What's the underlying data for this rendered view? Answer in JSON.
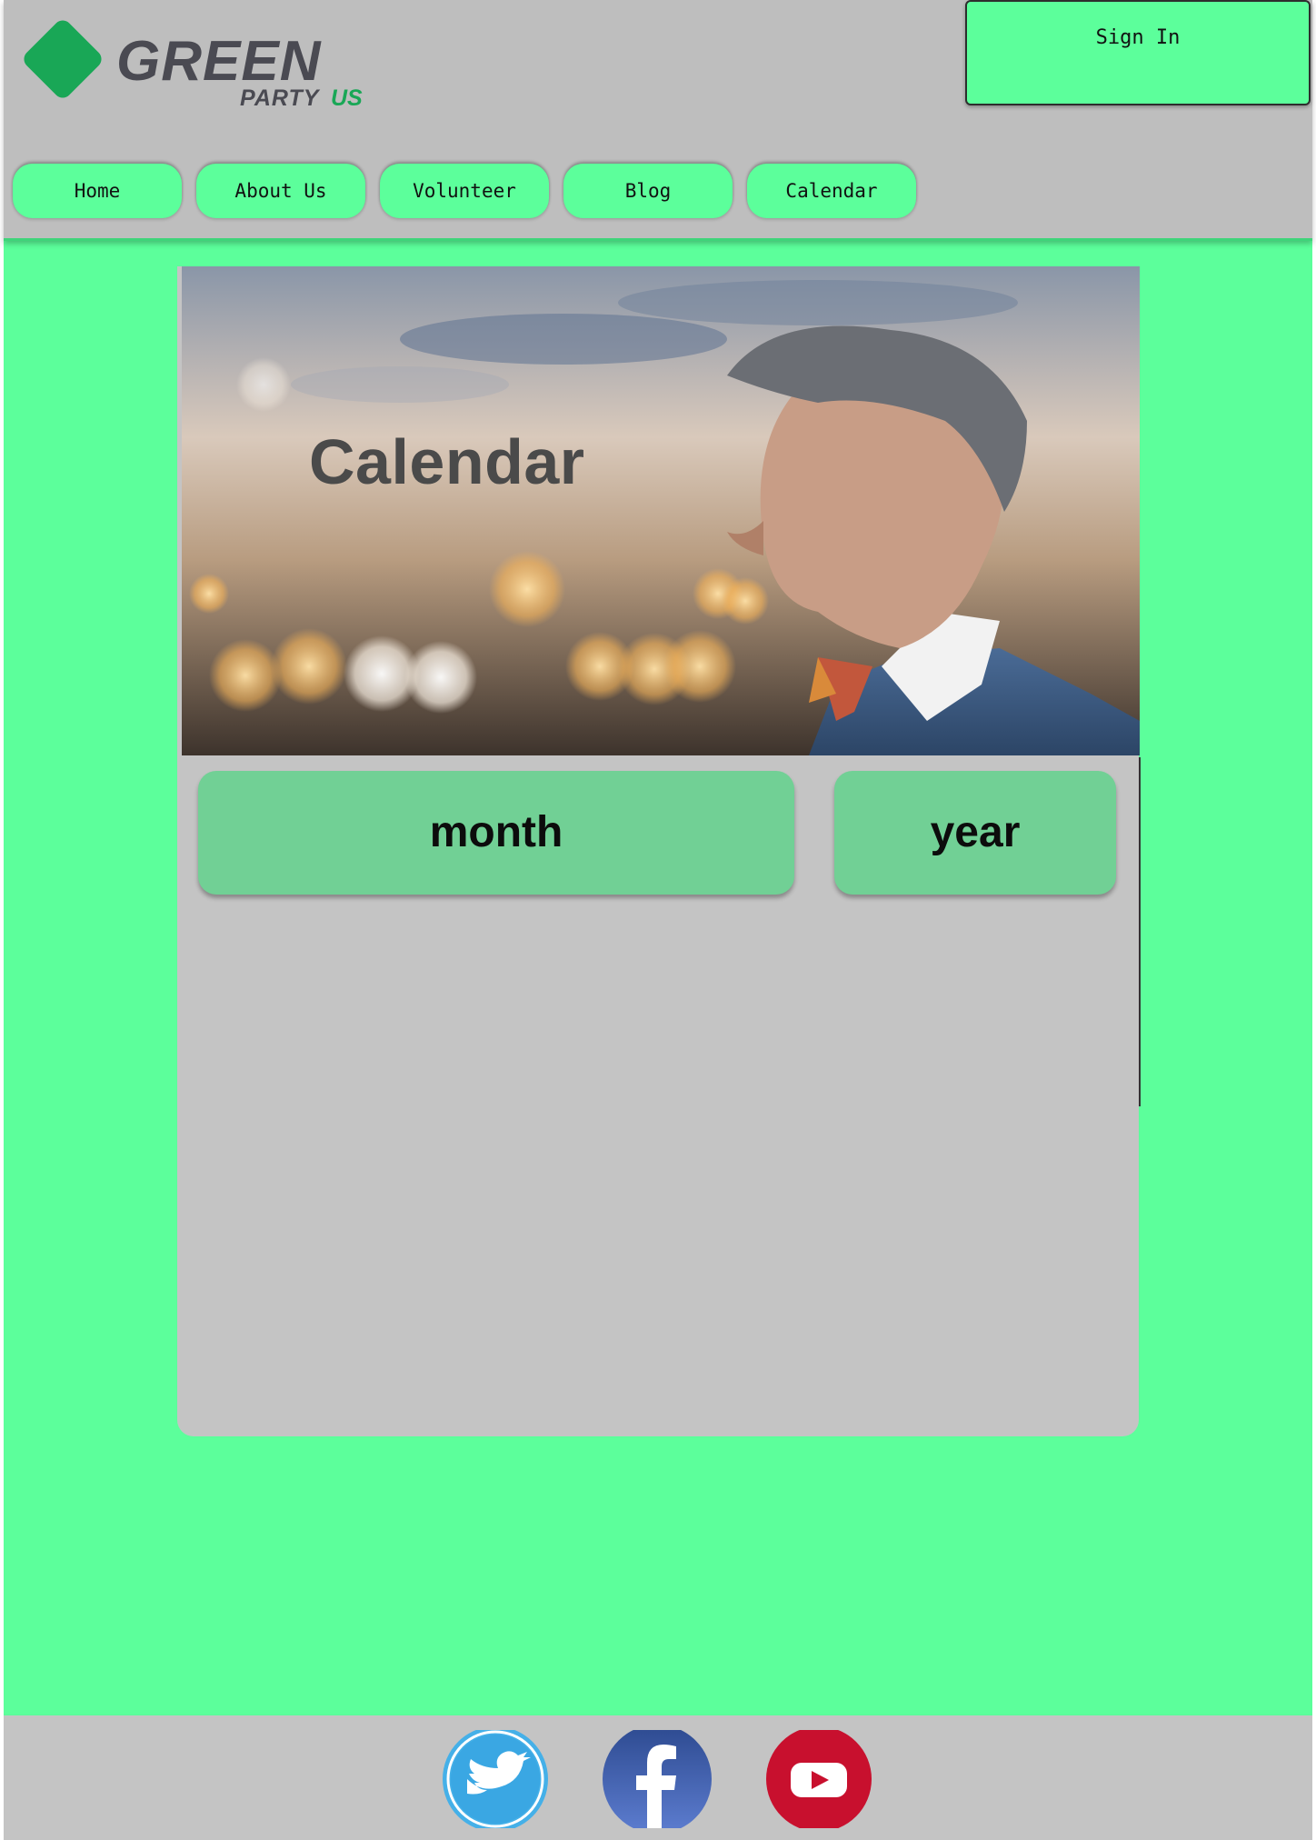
{
  "brand": {
    "name": "GREEN",
    "sub": "PARTY",
    "country": "US"
  },
  "header": {
    "signin_label": "Sign In"
  },
  "nav": {
    "items": [
      {
        "label": "Home"
      },
      {
        "label": "About Us"
      },
      {
        "label": "Volunteer"
      },
      {
        "label": "Blog"
      },
      {
        "label": "Calendar"
      }
    ]
  },
  "hero": {
    "title": "Calendar"
  },
  "view_toggle": {
    "month_label": "month",
    "year_label": "year"
  },
  "footer": {
    "social": [
      {
        "icon": "twitter-icon"
      },
      {
        "icon": "facebook-icon"
      },
      {
        "icon": "youtube-icon"
      }
    ]
  },
  "colors": {
    "page_green": "#5cff9b",
    "header_gray": "#bebebe",
    "panel_gray": "#c4c4c4",
    "segment_green": "#71d095",
    "logo_green": "#19a756",
    "logo_gray": "#4a4a52"
  }
}
